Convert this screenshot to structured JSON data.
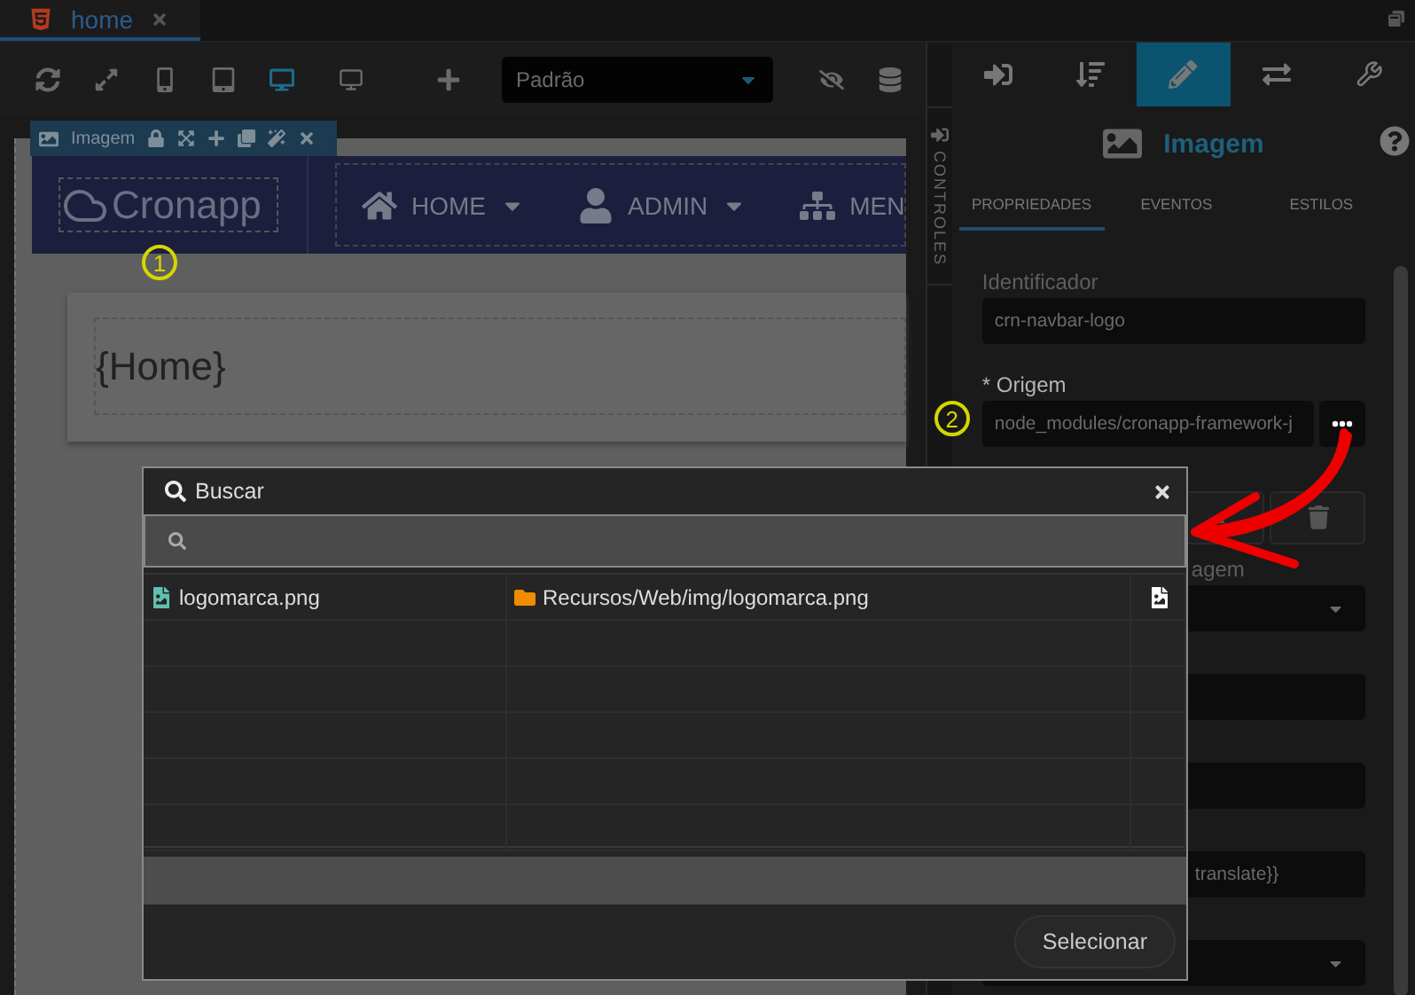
{
  "tabs": [
    {
      "label": "home",
      "selected": true
    }
  ],
  "toolbar": {
    "buttons": [
      {
        "kind": "refresh",
        "selected": false
      },
      {
        "kind": "fullscreen",
        "selected": false
      },
      {
        "kind": "phone",
        "selected": false
      },
      {
        "kind": "tablet",
        "selected": false
      },
      {
        "kind": "desktop",
        "selected": true
      },
      {
        "kind": "monitor",
        "selected": false
      }
    ],
    "profile": {
      "value": "Padrão"
    }
  },
  "canvas": {
    "component_bar": {
      "label": "Imagem"
    },
    "logo": "Cronapp",
    "nav_items": [
      "HOME",
      "ADMIN",
      "MEN"
    ],
    "heading": "{Home}",
    "callout": "1"
  },
  "side_strip": {
    "label": "CONTROLES"
  },
  "panel": {
    "icon_tabs": [
      {
        "kind": "import",
        "selected": false
      },
      {
        "kind": "tree",
        "selected": false
      },
      {
        "kind": "edit",
        "selected": true
      },
      {
        "kind": "resize",
        "selected": false
      },
      {
        "kind": "tools",
        "selected": false
      }
    ],
    "title": "Imagem",
    "tabs": [
      {
        "label": "PROPRIEDADES",
        "selected": true
      },
      {
        "label": "EVENTOS",
        "selected": false
      },
      {
        "label": "ESTILOS",
        "selected": false
      }
    ],
    "fields": [
      {
        "kind": "input",
        "label": "Identificador",
        "value": "crn-navbar-logo"
      },
      {
        "kind": "picker",
        "label": "* Origem",
        "value": "node_modules/cronapp-framework-j",
        "callout": "2"
      },
      {
        "kind": "buttons"
      },
      {
        "kind": "select",
        "label": "agem"
      },
      {
        "kind": "input"
      },
      {
        "kind": "input"
      },
      {
        "kind": "input",
        "value": "translate}}"
      },
      {
        "kind": "select"
      }
    ]
  },
  "dialog": {
    "title": "Buscar",
    "rows": [
      {
        "name": "logomarca.png",
        "path": "Recursos/Web/img/logomarca.png"
      }
    ],
    "button": "Selecionar"
  }
}
